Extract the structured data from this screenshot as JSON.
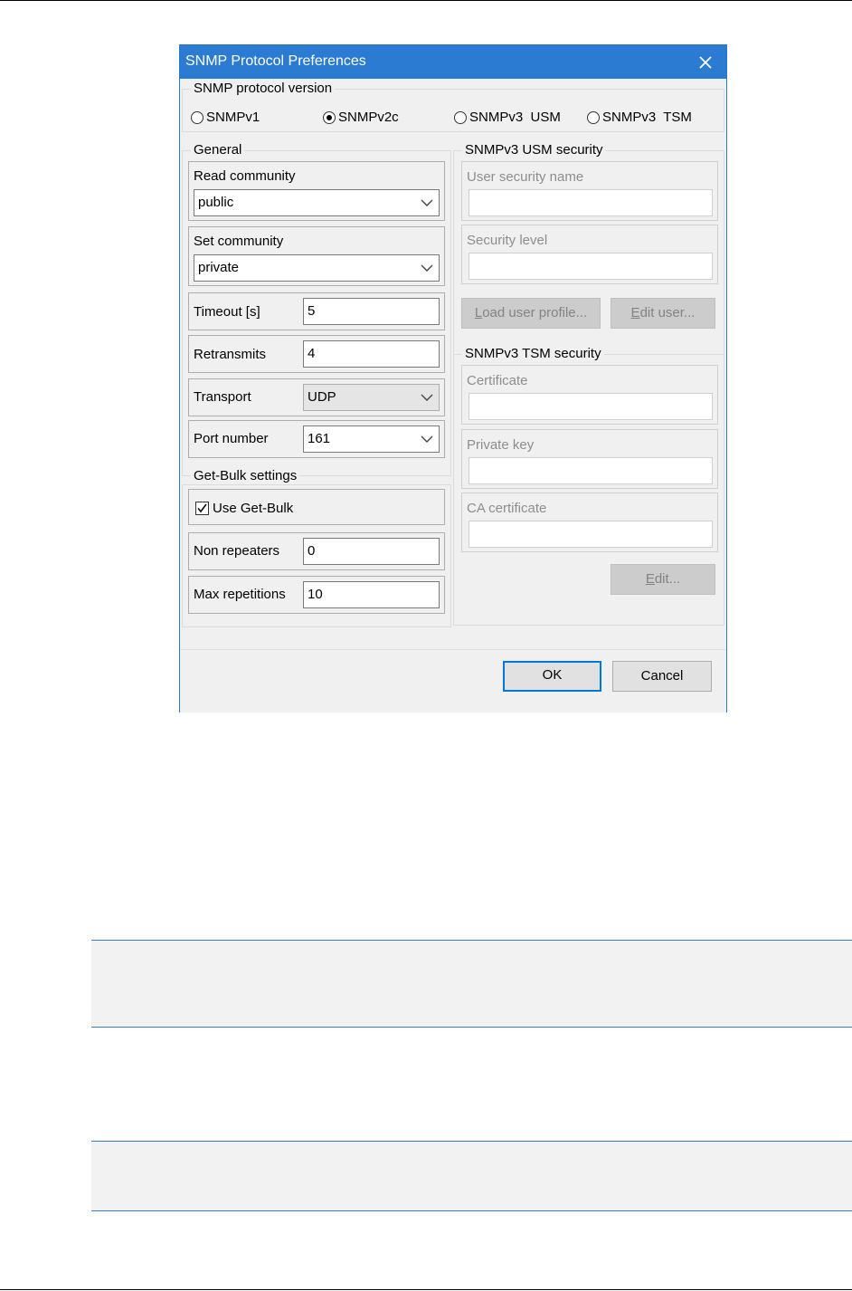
{
  "dialog": {
    "title": "SNMP Protocol Preferences",
    "close_icon": "close-icon",
    "version_group": {
      "legend": "SNMP protocol version",
      "options": [
        "SNMPv1",
        "SNMPv2c",
        "SNMPv3  USM",
        "SNMPv3  TSM"
      ],
      "selected": "SNMPv2c"
    },
    "general": {
      "legend": "General",
      "read_community": {
        "label": "Read community",
        "value": "public"
      },
      "set_community": {
        "label": "Set community",
        "value": "private"
      },
      "timeout": {
        "label": "Timeout [s]",
        "value": "5"
      },
      "retransmits": {
        "label": "Retransmits",
        "value": "4"
      },
      "transport": {
        "label": "Transport",
        "value": "UDP"
      },
      "port_number": {
        "label": "Port number",
        "value": "161"
      }
    },
    "get_bulk": {
      "legend": "Get-Bulk settings",
      "use_get_bulk": {
        "label": "Use Get-Bulk",
        "checked": true
      },
      "non_repeaters": {
        "label": "Non repeaters",
        "value": "0"
      },
      "max_repetitions": {
        "label": "Max repetitions",
        "value": "10"
      }
    },
    "usm": {
      "legend": "SNMPv3 USM security",
      "user_security_name": {
        "label": "User security name",
        "value": ""
      },
      "security_level": {
        "label": "Security level",
        "value": ""
      },
      "load_user_profile": {
        "mnemonic": "L",
        "rest": "oad user profile..."
      },
      "edit_user": {
        "mnemonic": "E",
        "rest": "dit user..."
      }
    },
    "tsm": {
      "legend": "SNMPv3 TSM security",
      "certificate": {
        "label": "Certificate",
        "value": ""
      },
      "private_key": {
        "label": "Private key",
        "value": ""
      },
      "ca_certificate": {
        "label": "CA certificate",
        "value": ""
      },
      "edit": {
        "mnemonic": "E",
        "rest": "dit..."
      }
    },
    "buttons": {
      "ok": "OK",
      "cancel": "Cancel"
    }
  },
  "colors": {
    "titlebar": "#2b7bd2",
    "accent": "#0078d7",
    "band_border": "#3a7fc4"
  }
}
